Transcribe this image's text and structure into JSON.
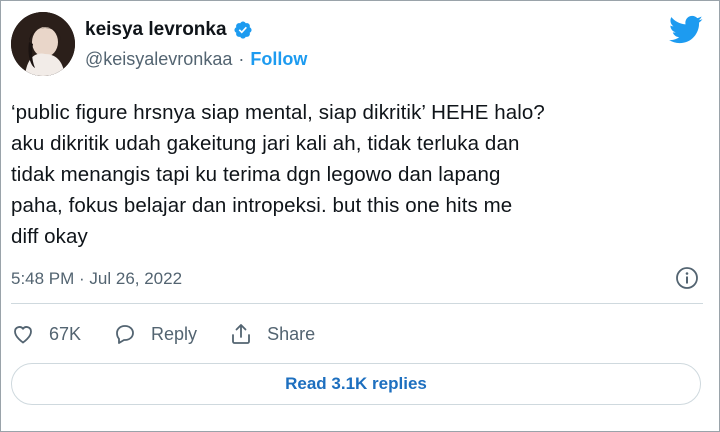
{
  "user": {
    "display_name": "keisya levronka",
    "handle": "@keisyalevronkaa",
    "separator": "·",
    "follow_label": "Follow",
    "verified_icon": "verified-badge-icon",
    "avatar_icon": "profile-photo"
  },
  "brand": {
    "logo_icon": "twitter-bird-icon",
    "accent": "#1d9bf0"
  },
  "tweet": {
    "text": "‘public figure hrsnya siap mental, siap dikritik’ HEHE halo?\naku dikritik udah gakeitung jari kali ah, tidak terluka dan\ntidak menangis tapi ku terima dgn legowo dan lapang\npaha, fokus belajar dan intropeksi. but this one hits me\ndiff okay",
    "timestamp": "5:48 PM · Jul 26, 2022",
    "info_icon": "info-icon"
  },
  "actions": {
    "like_count": "67K",
    "like_icon": "heart-icon",
    "reply_label": "Reply",
    "reply_icon": "reply-bubble-icon",
    "share_label": "Share",
    "share_icon": "share-icon"
  },
  "replies_button": {
    "label": "Read 3.1K replies"
  }
}
